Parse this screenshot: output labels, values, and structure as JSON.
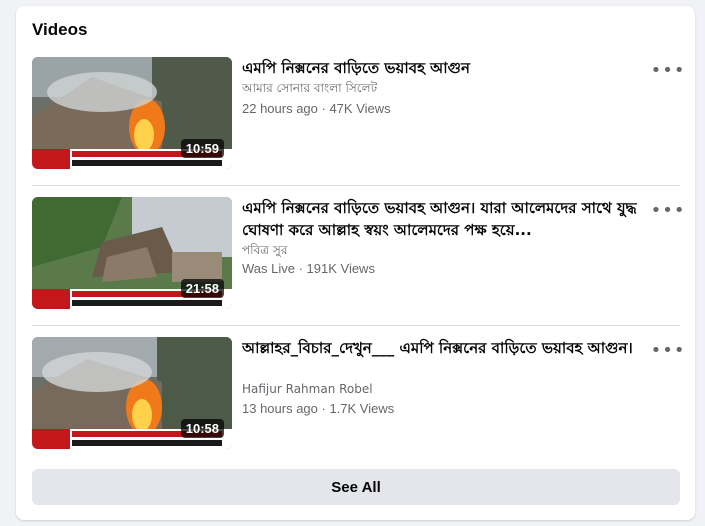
{
  "section": {
    "title": "Videos"
  },
  "videos": [
    {
      "title": "এমপি নিক্সনের বাড়িতে ভয়াবহ আগুন",
      "channel": "আমার সোনার বাংলা সিলেট",
      "meta": "22 hours ago · 47K Views",
      "duration": "10:59",
      "more_icon": "more-horizontal-icon"
    },
    {
      "title": "এমপি নিক্সনের বাড়িতে ভয়াবহ আগুন। যারা আলেমদের সাথে যুদ্ধ ঘোষণা করে আল্লাহ স্বয়ং আলেমদের পক্ষ হয়ে...",
      "channel": "পবিত্র সুর",
      "meta": "Was Live · 191K Views",
      "duration": "21:58",
      "more_icon": "more-horizontal-icon"
    },
    {
      "title": "আল্লাহর_বিচার_দেখুন___ এমপি নিক্সনের বাড়িতে ভয়াবহ আগুন।",
      "channel": "Hafijur Rahman Robel",
      "meta": "13 hours ago · 1.7K Views",
      "duration": "10:58",
      "more_icon": "more-horizontal-icon"
    }
  ],
  "see_all_label": "See All",
  "colors": {
    "card": "#ffffff",
    "page": "#f0f2f5",
    "secondary_text": "#65676b",
    "button_bg": "#e4e6eb"
  }
}
